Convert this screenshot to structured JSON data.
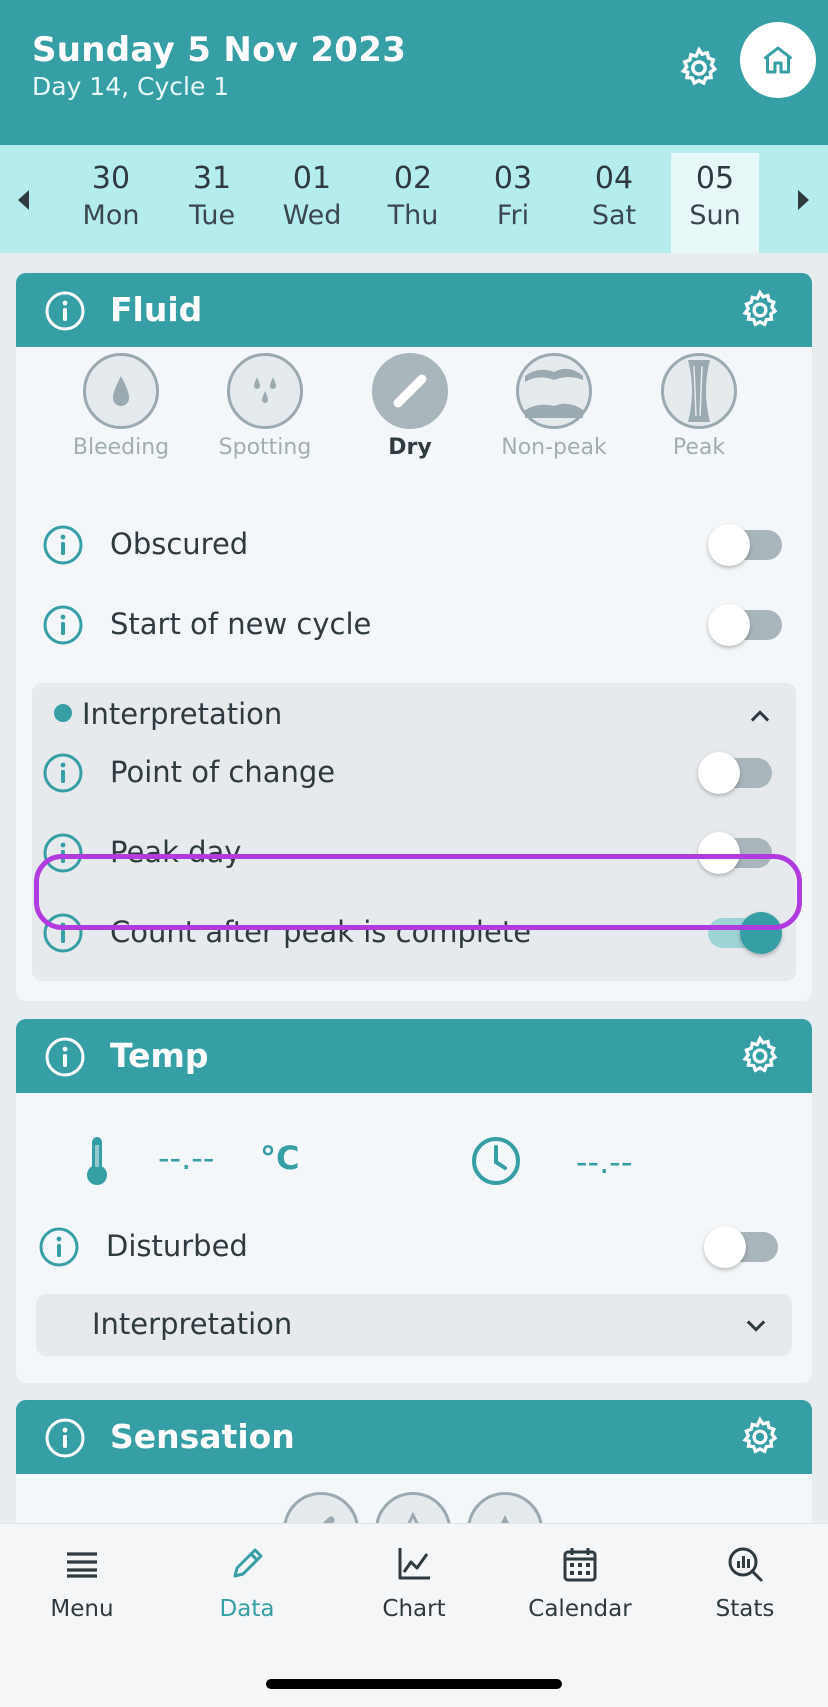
{
  "header": {
    "title": "Sunday 5 Nov 2023",
    "subtitle": "Day 14, Cycle 1"
  },
  "date_strip": {
    "days": [
      {
        "num": "30",
        "weekday": "Mon",
        "selected": false
      },
      {
        "num": "31",
        "weekday": "Tue",
        "selected": false
      },
      {
        "num": "01",
        "weekday": "Wed",
        "selected": false
      },
      {
        "num": "02",
        "weekday": "Thu",
        "selected": false
      },
      {
        "num": "03",
        "weekday": "Fri",
        "selected": false
      },
      {
        "num": "04",
        "weekday": "Sat",
        "selected": false
      },
      {
        "num": "05",
        "weekday": "Sun",
        "selected": true
      }
    ]
  },
  "fluid": {
    "title": "Fluid",
    "options": [
      {
        "label": "Bleeding",
        "icon": "drop-icon",
        "selected": false
      },
      {
        "label": "Spotting",
        "icon": "spots-icon",
        "selected": false
      },
      {
        "label": "Dry",
        "icon": "dry-stroke-icon",
        "selected": true
      },
      {
        "label": "Non-peak",
        "icon": "non-peak-icon",
        "selected": false
      },
      {
        "label": "Peak",
        "icon": "peak-icon",
        "selected": false
      }
    ],
    "obscured": {
      "label": "Obscured",
      "on": false
    },
    "new_cycle": {
      "label": "Start of new cycle",
      "on": false
    },
    "interpretation": {
      "title": "Interpretation",
      "expanded": true,
      "point_of_change": {
        "label": "Point of change",
        "on": false
      },
      "peak_day": {
        "label": "Peak day",
        "on": false
      },
      "count_after_peak": {
        "label": "Count after peak is complete",
        "on": true
      }
    }
  },
  "temp": {
    "title": "Temp",
    "value": "--.--",
    "unit": "°C",
    "time": "--.--",
    "disturbed": {
      "label": "Disturbed",
      "on": false
    },
    "interpretation": {
      "title": "Interpretation",
      "expanded": false
    }
  },
  "sensation": {
    "title": "Sensation"
  },
  "bottom_nav": {
    "items": [
      {
        "label": "Menu",
        "icon": "menu-icon",
        "active": false
      },
      {
        "label": "Data",
        "icon": "pencil-icon",
        "active": true
      },
      {
        "label": "Chart",
        "icon": "chart-icon",
        "active": false
      },
      {
        "label": "Calendar",
        "icon": "calendar-icon",
        "active": false
      },
      {
        "label": "Stats",
        "icon": "stats-icon",
        "active": false
      }
    ]
  },
  "colors": {
    "primary": "#369fa5",
    "date_strip": "#b5ecee",
    "highlight": "#b23be0"
  }
}
